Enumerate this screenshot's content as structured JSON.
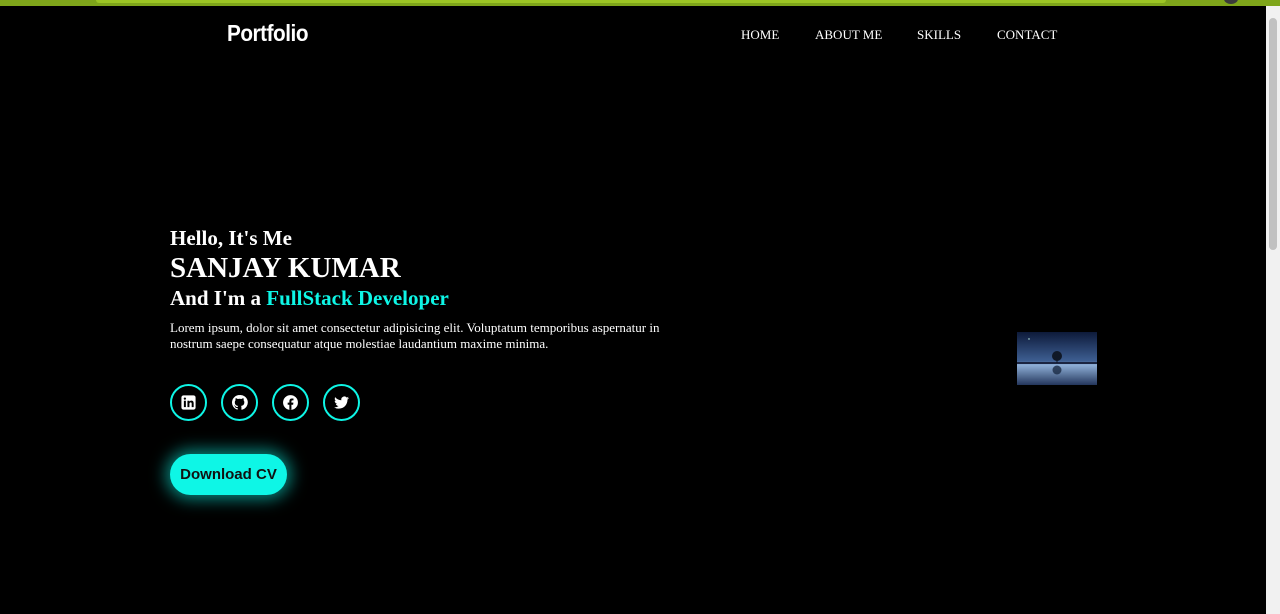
{
  "brand": {
    "logo": "Portfolio"
  },
  "nav": {
    "items": [
      "HOME",
      "ABOUT ME",
      "SKILLS",
      "CONTACT"
    ]
  },
  "hero": {
    "greeting": "Hello, It's Me",
    "name": "SANJAY KUMAR",
    "role_prefix": "And I'm a ",
    "role_highlight": "FullStack Developer",
    "description": "Lorem ipsum, dolor sit amet consectetur adipisicing elit. Voluptatum temporibus aspernatur in nostrum saepe consequatur atque molestiae laudantium maxime minima.",
    "button_label": "Download CV"
  },
  "socials": [
    "linkedin-icon",
    "github-icon",
    "facebook-icon",
    "twitter-icon"
  ],
  "colors": {
    "accent": "#0ef6e6",
    "background": "#000000",
    "text": "#ffffff"
  }
}
